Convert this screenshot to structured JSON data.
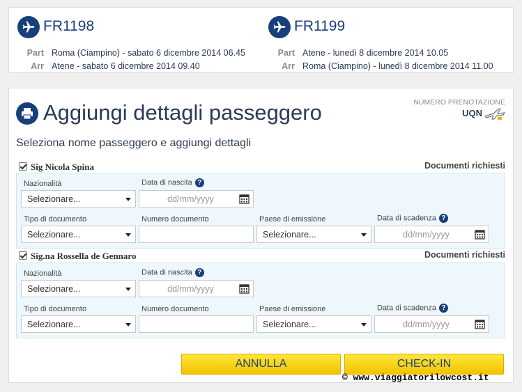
{
  "flights": [
    {
      "code": "FR1198",
      "depart_label": "Part",
      "depart": "Roma (Ciampino) - sabato 6 dicembre 2014 06.45",
      "arrive_label": "Arr",
      "arrive": "Atene - sabato 6 dicembre 2014 09.40"
    },
    {
      "code": "FR1199",
      "depart_label": "Part",
      "depart": "Atene - lunedì 8 dicembre 2014 10.05",
      "arrive_label": "Arr",
      "arrive": "Roma (Ciampino) - lunedì 8 dicembre 2014 11.00"
    }
  ],
  "form": {
    "title": "Aggiungi dettagli passeggero",
    "booking_label": "NUMERO PRENOTAZIONE",
    "booking_code": "UQN",
    "subtitle": "Seleziona nome passeggero e aggiungi dettagli",
    "labels": {
      "nationality": "Nazionalità",
      "birth_date": "Data di nascita",
      "doc_type": "Tipo di documento",
      "doc_number": "Numero documento",
      "issue_country": "Paese di emissione",
      "expiry_date": "Data di scadenza",
      "docs_required": "Documenti richiesti",
      "help": "?"
    },
    "passengers": [
      {
        "name": "Sig Nicola Spina",
        "checked": true,
        "nationality": "Selezionare...",
        "birth_date_placeholder": "dd/mm/yyyy",
        "doc_type": "Selezionare...",
        "doc_number": "",
        "issue_country": "Selezionare...",
        "expiry_placeholder": "dd/mm/yyyy"
      },
      {
        "name": "Sig.na Rossella de Gennaro",
        "checked": true,
        "nationality": "Selezionare...",
        "birth_date_placeholder": "dd/mm/yyyy",
        "doc_type": "Selezionare...",
        "doc_number": "",
        "issue_country": "Selezionare...",
        "expiry_placeholder": "dd/mm/yyyy"
      }
    ],
    "buttons": {
      "cancel": "ANNULLA",
      "checkin": "CHECK-IN"
    }
  },
  "watermark": "© www.viaggiatorilowcost.it",
  "colors": {
    "brand": "#173f7a",
    "button": "#f3c200",
    "panel_bg": "#eef7fc"
  },
  "icons": [
    "plane-icon",
    "printer-icon",
    "plane-doodle-icon",
    "calendar-icon",
    "help-icon",
    "checkbox-icon",
    "caret-down-icon"
  ]
}
